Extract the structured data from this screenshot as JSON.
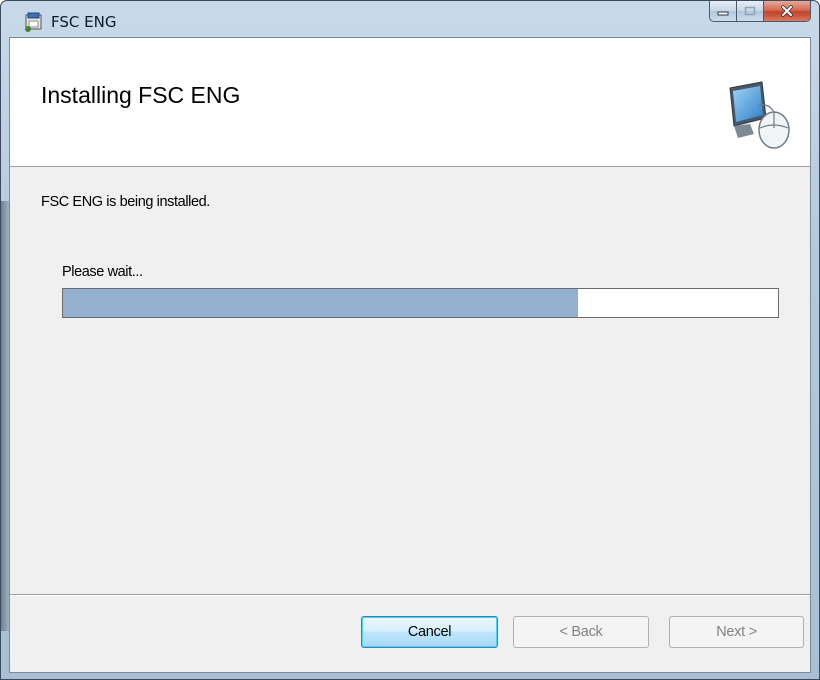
{
  "window": {
    "title": "FSC ENG",
    "controls": {
      "minimize": "minimize-icon",
      "maximize": "maximize-icon",
      "close": "close-icon"
    }
  },
  "header": {
    "title": "Installing FSC ENG",
    "graphic": "computer-with-mouse-icon"
  },
  "main": {
    "status_text": "FSC ENG is being installed.",
    "wait_label": "Please wait...",
    "progress": 0.72
  },
  "footer": {
    "cancel_label": "Cancel",
    "back_label": "< Back",
    "next_label": "Next >"
  },
  "colors": {
    "progress_fill": "#93b0ce",
    "close_button": "#c2432b",
    "focused_button_border": "#3c7fb1"
  }
}
